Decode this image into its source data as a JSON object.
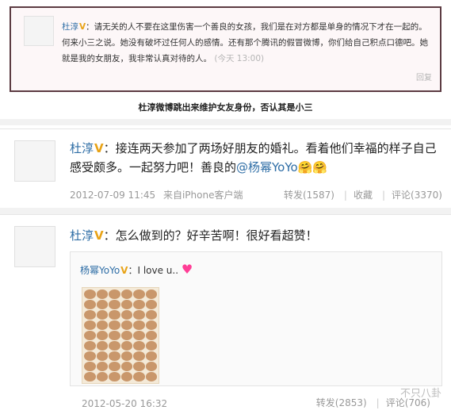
{
  "post1": {
    "author": "杜淳",
    "badge": "V",
    "text": "：请无关的人不要在这里伤害一个善良的女孩，我们是在对方都是单身的情况下才在一起的。何来小三之说。她没有破坏过任何人的感情。还有那个腾讯的假冒微博，你们给自己积点口德吧。她就是我的女朋友，我非常认真对待的人。",
    "time": "(今天 13:00)",
    "reply": "回复"
  },
  "caption": "杜淳微博跳出来维护女友身份，否认其是小三",
  "post2": {
    "author": "杜淳",
    "badge": "V",
    "text_pre": "：接连两天参加了两场好朋友的婚礼。看着他们幸福的样子自己感受颇多。一起努力吧！善良的",
    "mention": "@杨幂YoYo",
    "emoji": "🤗🤗",
    "time": "2012-07-09 11:45",
    "source": "来自iPhone客户端",
    "repost": "转发(1587)",
    "fav": "收藏",
    "comment": "评论(3370)"
  },
  "post3": {
    "author": "杜淳",
    "badge": "V",
    "text": "：怎么做到的？好辛苦啊！很好看超赞！",
    "quote": {
      "author": "杨幂YoYo",
      "badge": "V",
      "text": "：I love u..",
      "heart": "♥"
    },
    "time": "2012-05-20 16:32",
    "repost": "转发(2853)",
    "comment": "评论(706)"
  },
  "watermark": "不只八卦"
}
